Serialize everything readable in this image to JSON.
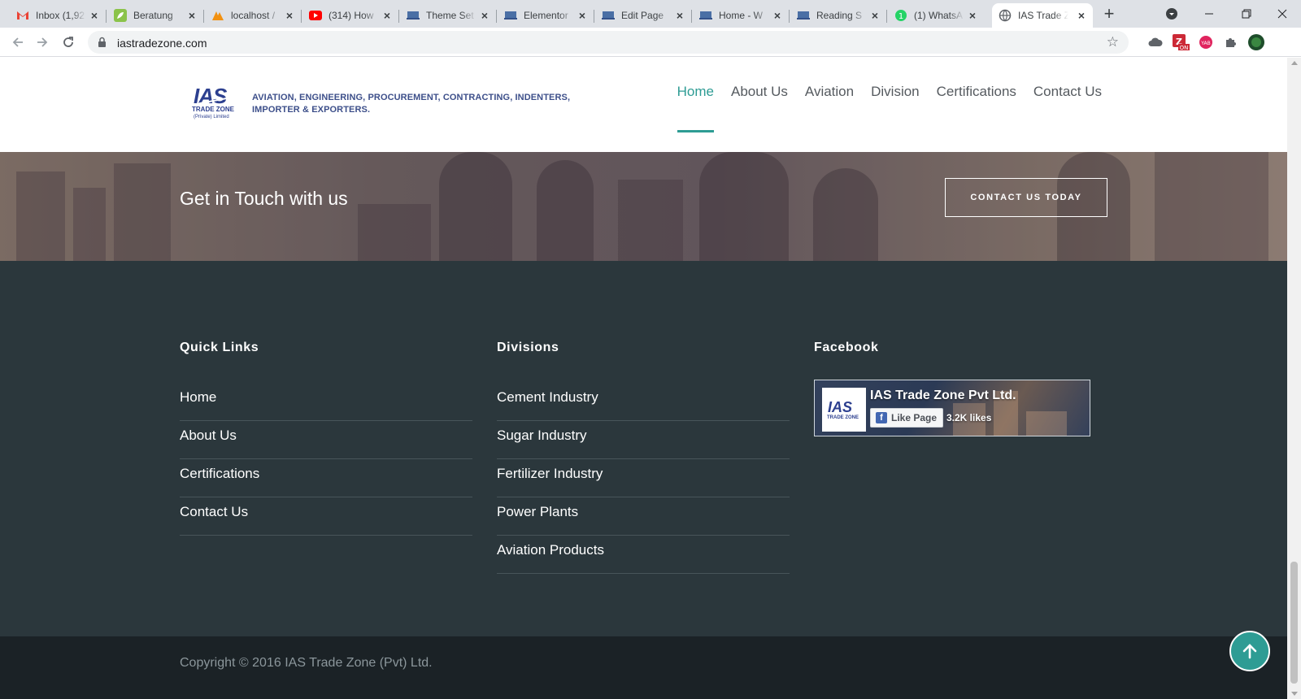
{
  "browser": {
    "tabs": [
      {
        "title": "Inbox (1,92",
        "icon": "gmail-icon",
        "active": false
      },
      {
        "title": "Beratung",
        "icon": "leaf-icon",
        "active": false
      },
      {
        "title": "localhost /",
        "icon": "phpmyadmin-icon",
        "active": false
      },
      {
        "title": "(314) How",
        "icon": "youtube-icon",
        "active": false
      },
      {
        "title": "Theme Set",
        "icon": "site-icon",
        "active": false
      },
      {
        "title": "Elementor",
        "icon": "site-icon",
        "active": false
      },
      {
        "title": "Edit Page",
        "icon": "site-icon",
        "active": false
      },
      {
        "title": "Home - W",
        "icon": "site-icon",
        "active": false
      },
      {
        "title": "Reading S",
        "icon": "site-icon",
        "active": false
      },
      {
        "title": "(1) WhatsA",
        "icon": "whatsapp-icon",
        "active": false
      },
      {
        "title": "IAS Trade Z",
        "icon": "globe-icon",
        "active": true
      }
    ],
    "url": "iastradezone.com"
  },
  "header": {
    "logo_text": "IAS",
    "logo_sub": "TRADE ZONE",
    "logo_sub2": "(Private) Limited",
    "tagline_line1": "AVIATION, ENGINEERING, PROCUREMENT, CONTRACTING, INDENTERS,",
    "tagline_line2": "IMPORTER & EXPORTERS.",
    "nav": [
      {
        "label": "Home",
        "active": true
      },
      {
        "label": "About Us",
        "active": false
      },
      {
        "label": "Aviation",
        "active": false
      },
      {
        "label": "Division",
        "active": false
      },
      {
        "label": "Certifications",
        "active": false
      },
      {
        "label": "Contact Us",
        "active": false
      }
    ]
  },
  "cta": {
    "title": "Get in Touch with us",
    "button_label": "CONTACT US TODAY"
  },
  "footer": {
    "quick_links": {
      "heading": "Quick Links",
      "items": [
        "Home",
        "About Us",
        "Certifications",
        "Contact Us"
      ]
    },
    "divisions": {
      "heading": "Divisions",
      "items": [
        "Cement Industry",
        "Sugar Industry",
        "Fertilizer Industry",
        "Power Plants",
        "Aviation Products"
      ]
    },
    "facebook": {
      "heading": "Facebook",
      "page_name": "IAS Trade Zone Pvt Ltd.",
      "like_label": "Like Page",
      "likes": "3.2K likes"
    },
    "copyright": "Copyright © 2016 IAS Trade Zone (Pvt) Ltd."
  },
  "colors": {
    "accent": "#2e9c94",
    "footer_bg": "#2b373c",
    "copyright_bg": "#1b2226",
    "logo_blue": "#2c3f8f"
  }
}
